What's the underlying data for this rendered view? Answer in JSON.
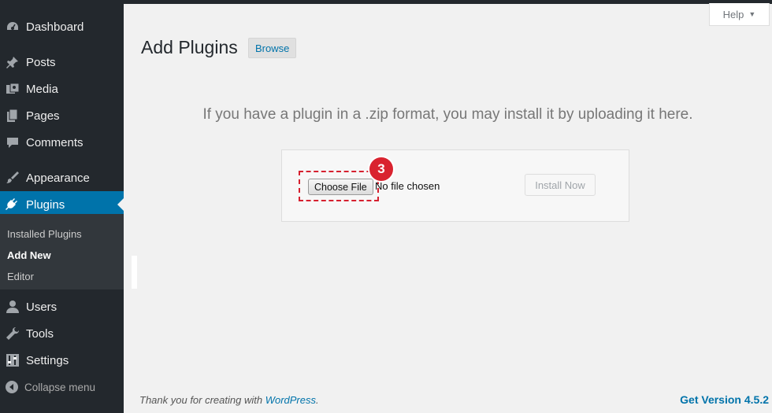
{
  "sidebar": {
    "items": [
      {
        "label": "Dashboard",
        "icon": "dashboard-icon"
      },
      {
        "label": "Posts",
        "icon": "pushpin-icon"
      },
      {
        "label": "Media",
        "icon": "media-icon"
      },
      {
        "label": "Pages",
        "icon": "pages-icon"
      },
      {
        "label": "Comments",
        "icon": "comment-icon"
      },
      {
        "label": "Appearance",
        "icon": "brush-icon"
      },
      {
        "label": "Plugins",
        "icon": "plugin-icon"
      },
      {
        "label": "Users",
        "icon": "user-icon"
      },
      {
        "label": "Tools",
        "icon": "wrench-icon"
      },
      {
        "label": "Settings",
        "icon": "settings-icon"
      }
    ],
    "submenu": [
      "Installed Plugins",
      "Add New",
      "Editor"
    ],
    "collapse_label": "Collapse menu"
  },
  "header": {
    "help_label": "Help",
    "title": "Add Plugins",
    "browse_label": "Browse"
  },
  "upload": {
    "description": "If you have a plugin in a .zip format, you may install it by uploading it here.",
    "choose_label": "Choose File",
    "no_file_text": "No file chosen",
    "install_label": "Install Now",
    "step_badge": "3"
  },
  "footer": {
    "thanks_prefix": "Thank you for creating with ",
    "thanks_link": "WordPress",
    "thanks_suffix": ".",
    "version_label": "Get Version 4.5.2"
  },
  "colors": {
    "accent": "#0073aa",
    "sidebar_bg": "#23282d",
    "badge": "#d9232f"
  }
}
